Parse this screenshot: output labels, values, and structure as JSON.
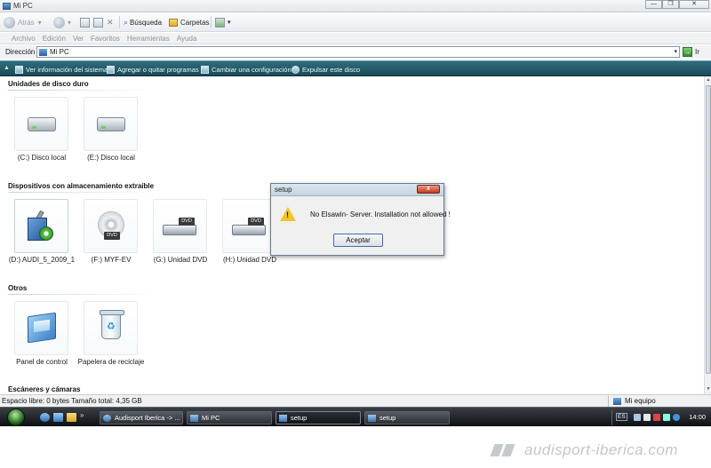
{
  "window": {
    "title": "Mi PC",
    "controls": {
      "minimize": "—",
      "maximize": "❐",
      "close": "✕"
    }
  },
  "toolbar": {
    "back": "Atrás",
    "search": "Búsqueda",
    "folders": "Carpetas"
  },
  "menu": [
    "Archivo",
    "Edición",
    "Ver",
    "Favoritos",
    "Herramientas",
    "Ayuda"
  ],
  "address": {
    "label": "Dirección",
    "value": "Mi PC",
    "go": "Ir"
  },
  "tasks": [
    "Ver información del sistema",
    "Agregar o quitar programas",
    "Cambiar una configuración",
    "Expulsar este disco"
  ],
  "sections": {
    "hard_disks": "Unidades de disco duro",
    "removable": "Dispositivos con almacenamiento extraíble",
    "others": "Otros",
    "scanners": "Escáneres y cámaras"
  },
  "drives": {
    "hard": [
      "(C:) Disco local",
      "(E:) Disco local"
    ],
    "removable": [
      "(D:) AUDI_5_2009_1",
      "(F:) MYF-EV",
      "(G:) Unidad DVD",
      "(H:) Unidad DVD"
    ],
    "dvd_label": "DVD",
    "others": [
      "Panel de control",
      "Papelera de reciclaje"
    ]
  },
  "dialog": {
    "title": "setup",
    "close": "x",
    "message": "No Elsawin- Server. Installation not allowed !",
    "ok": "Aceptar"
  },
  "status": {
    "left": "Espacio libre: 0 bytes Tamaño total: 4,35 GB",
    "right": "Mi equipo"
  },
  "taskbar": {
    "buttons": [
      "Audisport Iberica -> ...",
      "Mi PC",
      "setup",
      "setup"
    ],
    "clock": "14:00",
    "tray_lang": "ES"
  },
  "watermark": "audisport-iberica.com"
}
